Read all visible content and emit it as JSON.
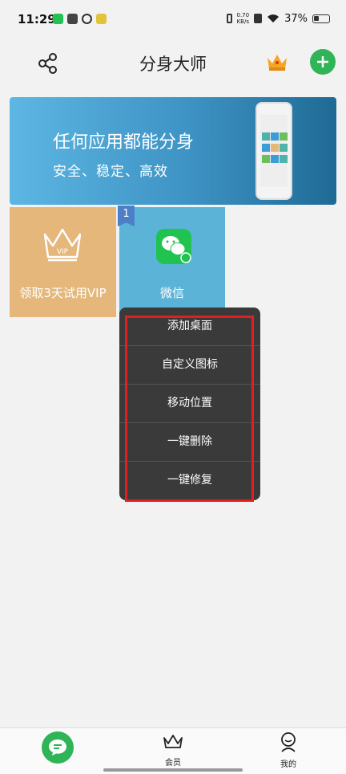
{
  "status_bar": {
    "time": "11:29",
    "net_speed_value": "0.70",
    "net_speed_unit": "KB/s",
    "battery": "37%",
    "icons": [
      "wechat-notif-icon",
      "app-notif-icon",
      "link-icon",
      "game-notif-icon",
      "vibrate-icon",
      "wifi-icon",
      "battery-icon"
    ]
  },
  "header": {
    "title": "分身大师",
    "icons": [
      "share-icon",
      "crown-icon",
      "add-icon"
    ]
  },
  "banner": {
    "title": "任何应用都能分身",
    "subtitle": "安全、稳定、高效"
  },
  "tiles": [
    {
      "label": "领取3天试用VIP",
      "icon": "vip-crown-icon"
    },
    {
      "label": "微信",
      "icon": "wechat-icon",
      "badge": "1"
    }
  ],
  "context_menu": {
    "items": [
      "添加桌面",
      "自定义图标",
      "移动位置",
      "一键删除",
      "一键修复"
    ]
  },
  "bottom_nav": {
    "items": [
      {
        "label": "",
        "icon": "chat-icon"
      },
      {
        "label": "会员",
        "icon": "crown-outline-icon"
      },
      {
        "label": "我的",
        "icon": "user-icon"
      }
    ]
  },
  "colors": {
    "accent_green": "#2fb457",
    "vip_tile": "#e5b77a",
    "wechat_tile": "#5bb4d8",
    "menu_bg": "#3a3a3a",
    "highlight": "#e02020"
  }
}
